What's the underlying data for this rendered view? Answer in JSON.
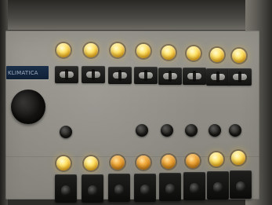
{
  "scene": {
    "type": "control-panel-photo",
    "label_plate_text": "KLIMATICA"
  },
  "indicator_lamps": {
    "top_row": [
      "bright",
      "bright",
      "bright",
      "bright",
      "bright",
      "bright",
      "bright",
      "bright"
    ],
    "bottom_row": [
      "bright",
      "bright",
      "amber",
      "amber",
      "amber",
      "amber",
      "bright",
      "bright"
    ]
  },
  "controls": {
    "rotary_knobs": 1,
    "small_knobs": 6,
    "top_selectors": 8,
    "bottom_switches": 8
  },
  "colors": {
    "panel": "#8f8d85",
    "lamp_bright": "#ffe46a",
    "lamp_amber": "#f2a93b",
    "label_plate": "#14263e"
  }
}
